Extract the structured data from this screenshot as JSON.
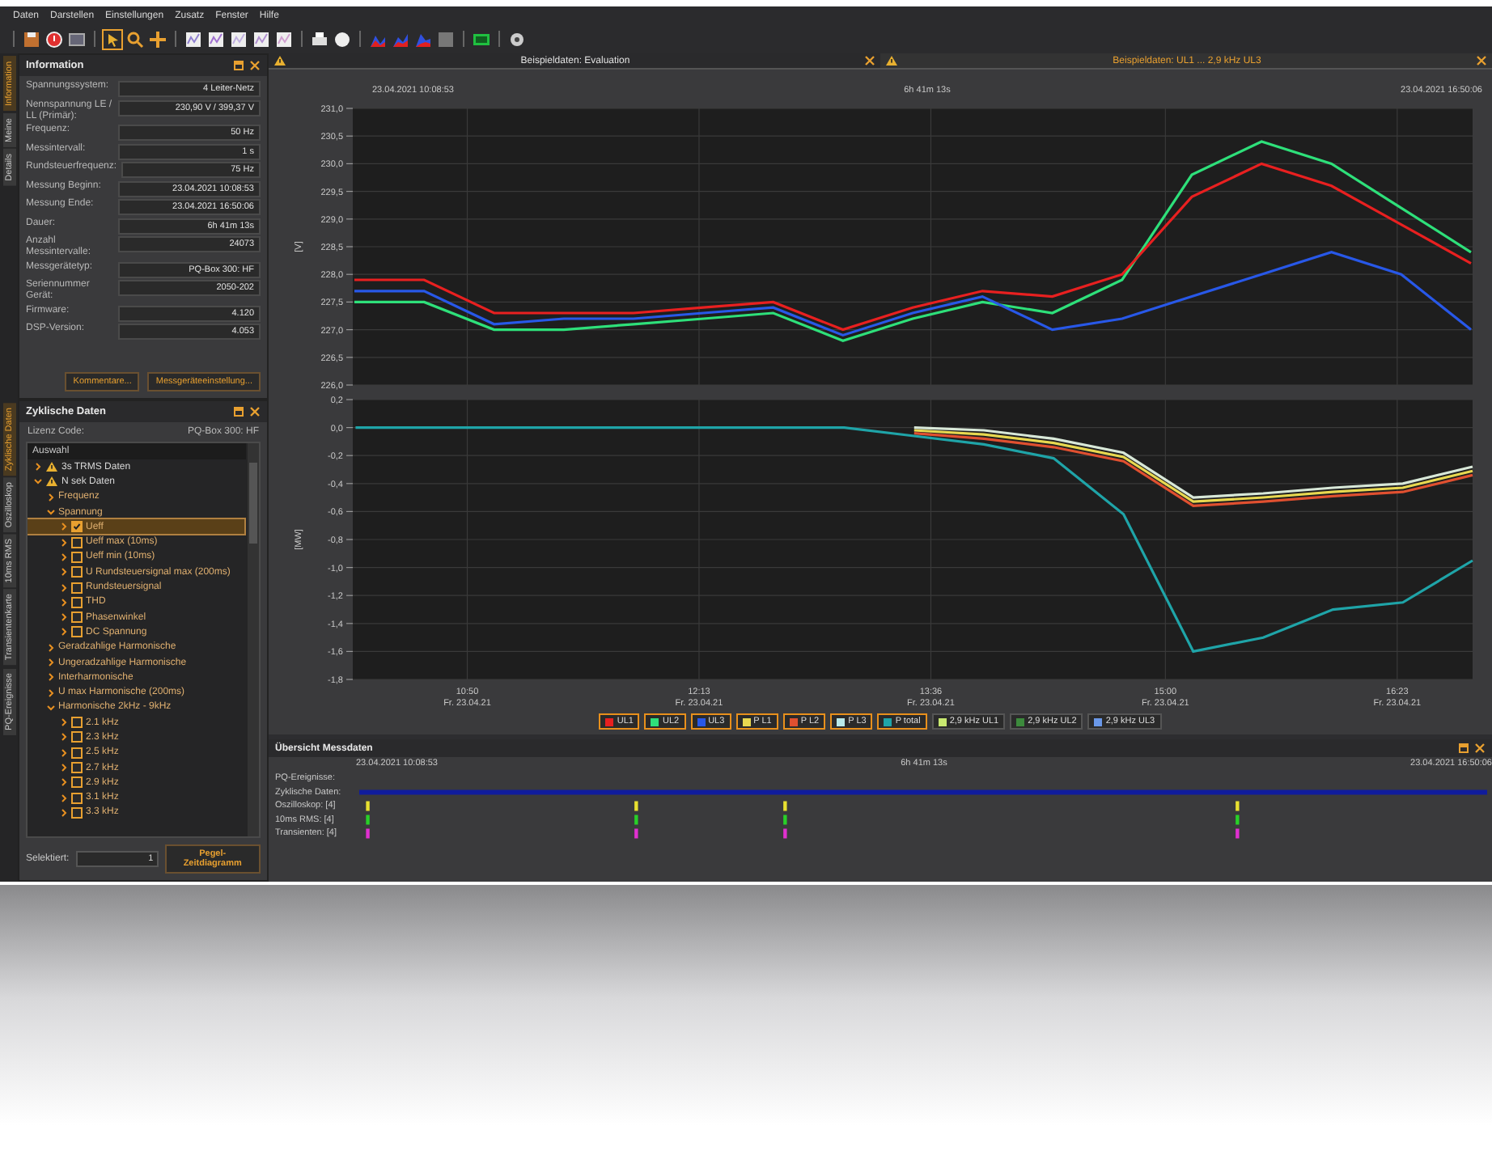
{
  "menu": [
    "Daten",
    "Darstellen",
    "Einstellungen",
    "Zusatz",
    "Fenster",
    "Hilfe"
  ],
  "info_panel": {
    "title": "Information",
    "side_tabs": [
      {
        "label": "Information",
        "selected": true
      },
      {
        "label": "Meine",
        "selected": false
      },
      {
        "label": "Details",
        "selected": false
      }
    ],
    "fields": [
      {
        "label": "Spannungssystem:",
        "value": "4 Leiter-Netz"
      },
      {
        "label": "Nennspannung LE / LL (Primär):",
        "value": "230,90 V / 399,37 V"
      },
      {
        "label": "Frequenz:",
        "value": "50 Hz"
      },
      {
        "label": "Messintervall:",
        "value": "1 s"
      },
      {
        "label": "Rundsteuerfrequenz:",
        "value": "75 Hz"
      },
      {
        "label": "Messung Beginn:",
        "value": "23.04.2021 10:08:53"
      },
      {
        "label": "Messung Ende:",
        "value": "23.04.2021 16:50:06"
      },
      {
        "label": "Dauer:",
        "value": "6h 41m 13s"
      },
      {
        "label": "Anzahl Messintervalle:",
        "value": "24073"
      },
      {
        "label": "Messgerätetyp:",
        "value": "PQ-Box 300: HF"
      },
      {
        "label": "Seriennummer Gerät:",
        "value": "2050-202"
      },
      {
        "label": "Firmware:",
        "value": "4.120"
      },
      {
        "label": "DSP-Version:",
        "value": "4.053"
      }
    ],
    "buttons": [
      "Kommentare...",
      "Messgeräteeinstellung..."
    ]
  },
  "cyclic_panel": {
    "title": "Zyklische Daten",
    "side_tabs": [
      {
        "label": "Zyklische Daten",
        "selected": true
      },
      {
        "label": "Oszilloskop",
        "selected": false
      },
      {
        "label": "10ms RMS",
        "selected": false
      },
      {
        "label": "Transientenkarte",
        "selected": false
      },
      {
        "label": "PQ-Ereignisse",
        "selected": false
      }
    ],
    "license_label": "Lizenz Code:",
    "license_value": "PQ-Box 300: HF",
    "list_header": "Auswahl",
    "tree": [
      {
        "kind": "dataset",
        "label": "3s TRMS Daten",
        "expanded": false
      },
      {
        "kind": "dataset",
        "label": "N sek Daten",
        "expanded": true,
        "children": [
          {
            "kind": "folder",
            "label": "Frequenz",
            "expanded": false
          },
          {
            "kind": "folder",
            "label": "Spannung",
            "expanded": true,
            "children": [
              {
                "kind": "checkbox",
                "label": "Ueff",
                "checked": true,
                "selected": true
              },
              {
                "kind": "checkbox",
                "label": "Ueff max (10ms)",
                "checked": false,
                "selected": false
              },
              {
                "kind": "checkbox",
                "label": "Ueff min (10ms)",
                "checked": false,
                "selected": false
              },
              {
                "kind": "checkbox",
                "label": "U Rundsteuersignal max (200ms)",
                "checked": false,
                "selected": false
              },
              {
                "kind": "checkbox",
                "label": "Rundsteuersignal",
                "checked": false,
                "selected": false
              },
              {
                "kind": "checkbox",
                "label": "THD",
                "checked": false,
                "selected": false
              },
              {
                "kind": "checkbox",
                "label": "Phasenwinkel",
                "checked": false,
                "selected": false
              },
              {
                "kind": "checkbox",
                "label": "DC Spannung",
                "checked": false,
                "selected": false
              }
            ]
          },
          {
            "kind": "folder",
            "label": "Geradzahlige Harmonische",
            "expanded": false
          },
          {
            "kind": "folder",
            "label": "Ungeradzahlige Harmonische",
            "expanded": false
          },
          {
            "kind": "folder",
            "label": "Interharmonische",
            "expanded": false
          },
          {
            "kind": "folder",
            "label": "U max Harmonische (200ms)",
            "expanded": false
          },
          {
            "kind": "folder",
            "label": "Harmonische 2kHz - 9kHz",
            "expanded": true,
            "children": [
              {
                "kind": "checkbox",
                "label": "2.1 kHz",
                "checked": false,
                "selected": false
              },
              {
                "kind": "checkbox",
                "label": "2.3 kHz",
                "checked": false,
                "selected": false
              },
              {
                "kind": "checkbox",
                "label": "2.5 kHz",
                "checked": false,
                "selected": false
              },
              {
                "kind": "checkbox",
                "label": "2.7 kHz",
                "checked": false,
                "selected": false
              },
              {
                "kind": "checkbox",
                "label": "2.9 kHz",
                "checked": false,
                "selected": false
              },
              {
                "kind": "checkbox",
                "label": "3.1 kHz",
                "checked": false,
                "selected": false
              },
              {
                "kind": "checkbox",
                "label": "3.3 kHz",
                "checked": false,
                "selected": false
              }
            ]
          }
        ]
      }
    ],
    "selected_label": "Selektiert:",
    "selected_value": "1",
    "button": "Pegel-Zeitdiagramm"
  },
  "document_tabs": [
    {
      "label": "Beispieldaten: Evaluation",
      "selected": false
    },
    {
      "label": "Beispieldaten: UL1 ... 2,9 kHz UL3",
      "selected": true
    }
  ],
  "chart_view": {
    "start": "23.04.2021 10:08:53",
    "duration": "6h 41m 13s",
    "end": "23.04.2021 16:50:06",
    "charts": [
      {
        "chart_data": {
          "type": "line",
          "ylabel": "[V]",
          "grid": true,
          "categories": [
            null,
            null,
            null,
            null,
            null,
            null,
            null,
            null,
            null,
            null,
            null,
            null,
            null,
            null,
            null,
            null,
            null
          ],
          "ylim": [
            226,
            231
          ],
          "yticks": [
            {
              "value": 231,
              "label": "231,0"
            },
            {
              "value": 230.5,
              "label": "230,5"
            },
            {
              "value": 230,
              "label": "230,0"
            },
            {
              "value": 229.5,
              "label": "229,5"
            },
            {
              "value": 229,
              "label": "229,0"
            },
            {
              "value": 228.5,
              "label": "228,5"
            },
            {
              "value": 228,
              "label": "228,0"
            },
            {
              "value": 227.5,
              "label": "227,5"
            },
            {
              "value": 227,
              "label": "227,0"
            },
            {
              "value": 226.5,
              "label": "226,5"
            },
            {
              "value": 226,
              "label": "226,0"
            }
          ],
          "series": [
            {
              "color": "#2ee07a",
              "values": [
                227.5,
                227.5,
                227.0,
                227.0,
                227.1,
                227.2,
                227.3,
                226.8,
                227.2,
                227.5,
                227.3,
                227.9,
                229.8,
                230.4,
                230.0,
                229.2,
                228.4
              ]
            },
            {
              "color": "#e82020",
              "values": [
                227.9,
                227.9,
                227.3,
                227.3,
                227.3,
                227.4,
                227.5,
                227.0,
                227.4,
                227.7,
                227.6,
                228.0,
                229.4,
                230.0,
                229.6,
                228.9,
                228.2
              ]
            },
            {
              "color": "#2858e8",
              "values": [
                227.7,
                227.7,
                227.1,
                227.2,
                227.2,
                227.3,
                227.4,
                226.9,
                227.3,
                227.6,
                227.0,
                227.2,
                227.6,
                228.0,
                228.4,
                228.0,
                227.0
              ]
            }
          ]
        }
      },
      {
        "chart_data": {
          "type": "line",
          "ylabel": "[MW]",
          "grid": true,
          "x": [
            610,
            635,
            660,
            685,
            710,
            735,
            760,
            785,
            810,
            835,
            860,
            885,
            910,
            935,
            960,
            985,
            1010
          ],
          "xlim": [
            609,
            1010
          ],
          "ylim": [
            -1.8,
            0.2
          ],
          "yticks": [
            {
              "value": 0.2,
              "label": "0,2"
            },
            {
              "value": 0,
              "label": "0,0"
            },
            {
              "value": -0.2,
              "label": "-0,2"
            },
            {
              "value": -0.4,
              "label": "-0,4"
            },
            {
              "value": -0.6,
              "label": "-0,6"
            },
            {
              "value": -0.8,
              "label": "-0,8"
            },
            {
              "value": -1,
              "label": "-1,0"
            },
            {
              "value": -1.2,
              "label": "-1,2"
            },
            {
              "value": -1.4,
              "label": "-1,4"
            },
            {
              "value": -1.6,
              "label": "-1,6"
            },
            {
              "value": -1.8,
              "label": "-1,8"
            }
          ],
          "xticks": [
            {
              "value": 650,
              "label": "10:50"
            },
            {
              "value": 733,
              "label": "12:13"
            },
            {
              "value": 816,
              "label": "13:36"
            },
            {
              "value": 900,
              "label": "15:00"
            },
            {
              "value": 983,
              "label": "16:23"
            }
          ],
          "series": [
            {
              "color": "#e05030",
              "values": [
                null,
                null,
                null,
                null,
                null,
                null,
                null,
                null,
                -0.04,
                -0.08,
                -0.14,
                -0.24,
                -0.56,
                -0.53,
                -0.49,
                -0.46,
                -0.34
              ]
            },
            {
              "color": "#e8d850",
              "values": [
                null,
                null,
                null,
                null,
                null,
                null,
                null,
                null,
                -0.02,
                -0.05,
                -0.11,
                -0.21,
                -0.53,
                -0.5,
                -0.46,
                -0.43,
                -0.31
              ]
            },
            {
              "color": "#d8e8d8",
              "values": [
                null,
                null,
                null,
                null,
                null,
                null,
                null,
                null,
                0,
                -0.02,
                -0.08,
                -0.18,
                -0.5,
                -0.47,
                -0.43,
                -0.4,
                -0.28
              ]
            },
            {
              "color": "#1fa4a8",
              "values": [
                0,
                0,
                0,
                0,
                0,
                0,
                0,
                0,
                -0.06,
                -0.12,
                -0.22,
                -0.62,
                -1.6,
                -1.5,
                -1.3,
                -1.25,
                -0.95
              ]
            }
          ]
        }
      }
    ],
    "x_dates": [
      "Fr. 23.04.21",
      "Fr. 23.04.21",
      "Fr. 23.04.21",
      "Fr. 23.04.21",
      "Fr. 23.04.21"
    ],
    "legend": [
      {
        "label": "UL1",
        "color": "#e82020",
        "selected": true
      },
      {
        "label": "UL2",
        "color": "#2ee07a",
        "selected": true
      },
      {
        "label": "UL3",
        "color": "#2858e8",
        "selected": true
      },
      {
        "label": "P L1",
        "color": "#e8d850",
        "selected": true
      },
      {
        "label": "P L2",
        "color": "#e05030",
        "selected": true
      },
      {
        "label": "P L3",
        "color": "#b8e8e8",
        "selected": true
      },
      {
        "label": "P total",
        "color": "#1fa4a8",
        "selected": true
      },
      {
        "label": "2,9 kHz UL1",
        "color": "#c8e870",
        "selected": false
      },
      {
        "label": "2,9 kHz UL2",
        "color": "#3c8a3c",
        "selected": false
      },
      {
        "label": "2,9 kHz UL3",
        "color": "#6a98e8",
        "selected": false
      }
    ]
  },
  "overview": {
    "title": "Übersicht Messdaten",
    "start": "23.04.2021 10:08:53",
    "duration": "6h 41m 13s",
    "end": "23.04.2021 16:50:06",
    "lanes": [
      {
        "label": "PQ-Ereignisse:"
      },
      {
        "label": "Zyklische Daten:",
        "kind": "span",
        "color": "#101c9c"
      },
      {
        "label": "Oszilloskop: [4]",
        "kind": "marks",
        "color": "#e8e030"
      },
      {
        "label": "10ms RMS: [4]",
        "kind": "marks",
        "color": "#28d028"
      },
      {
        "label": "Transienten: [4]",
        "kind": "marks",
        "color": "#e030d0"
      }
    ]
  }
}
